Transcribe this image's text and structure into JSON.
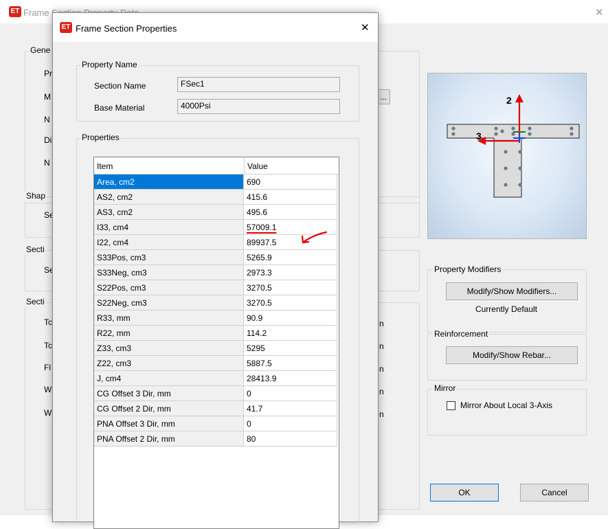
{
  "background_window": {
    "title": "Frame Section Property Data",
    "group_labels": {
      "general": "Gene",
      "shape": "Shap",
      "section_a": "Secti",
      "section_b": "Secti"
    },
    "general_letters": [
      "Pr",
      "M",
      "N",
      "Di",
      "N"
    ],
    "shape_letters": [
      "Se"
    ],
    "section_letters": [
      "Se"
    ],
    "section_b_letters": [
      "Tc",
      "Tc",
      "Fl",
      "W",
      "W"
    ],
    "unit_letters": [
      "n",
      "n",
      "n",
      "n",
      "n"
    ],
    "ellipsis_button": "...",
    "preview": {
      "axis2_label": "2",
      "axis3_label": "3"
    },
    "property_modifiers": {
      "label": "Property Modifiers",
      "button": "Modify/Show Modifiers...",
      "status": "Currently Default"
    },
    "reinforcement": {
      "label": "Reinforcement",
      "button": "Modify/Show Rebar..."
    },
    "mirror": {
      "label": "Mirror",
      "checkbox_label": "Mirror About Local 3-Axis",
      "checked": false
    },
    "ok_button": "OK",
    "cancel_button": "Cancel",
    "colors": {
      "axis_arrow": "#e00000",
      "preview_bg": "#dbe8f5",
      "selection": "#0078d7",
      "app_icon": "#d9241c"
    }
  },
  "dialog": {
    "title": "Frame Section Properties",
    "app_icon_text": "ET",
    "property_name_group": "Property Name",
    "section_name_label": "Section Name",
    "section_name_value": "FSec1",
    "base_material_label": "Base Material",
    "base_material_value": "4000Psi",
    "properties_group": "Properties",
    "table": {
      "headers": [
        "Item",
        "Value"
      ],
      "rows": [
        {
          "item": "Area, cm2",
          "value": "690",
          "selected": true
        },
        {
          "item": "AS2, cm2",
          "value": "415.6"
        },
        {
          "item": "AS3, cm2",
          "value": "495.6"
        },
        {
          "item": "I33, cm4",
          "value": "57009.1",
          "annotated": true
        },
        {
          "item": "I22, cm4",
          "value": "89937.5"
        },
        {
          "item": "S33Pos, cm3",
          "value": "5265.9"
        },
        {
          "item": "S33Neg, cm3",
          "value": "2973.3"
        },
        {
          "item": "S22Pos, cm3",
          "value": "3270.5"
        },
        {
          "item": "S22Neg, cm3",
          "value": "3270.5"
        },
        {
          "item": "R33, mm",
          "value": "90.9"
        },
        {
          "item": "R22, mm",
          "value": "114.2"
        },
        {
          "item": "Z33, cm3",
          "value": "5295"
        },
        {
          "item": "Z22, cm3",
          "value": "5887.5"
        },
        {
          "item": "J, cm4",
          "value": "28413.9"
        },
        {
          "item": "CG Offset 3 Dir, mm",
          "value": "0"
        },
        {
          "item": "CG Offset 2 Dir, mm",
          "value": "41.7"
        },
        {
          "item": "PNA Offset 3 Dir, mm",
          "value": "0"
        },
        {
          "item": "PNA Offset 2 Dir, mm",
          "value": "80"
        }
      ]
    }
  }
}
